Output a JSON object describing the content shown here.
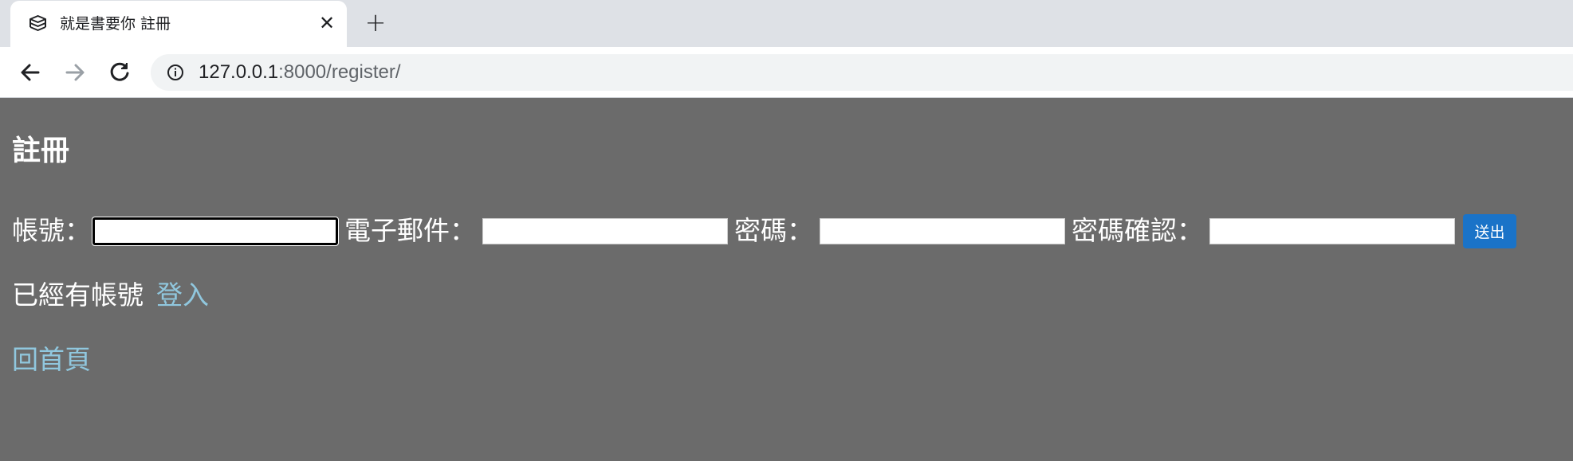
{
  "browser": {
    "tab": {
      "title": "就是書要你 註冊",
      "icon": "books-icon",
      "close_label": "✕"
    },
    "new_tab_label": "+",
    "toolbar": {
      "back_icon": "arrow-left-icon",
      "forward_icon": "arrow-right-icon",
      "reload_icon": "reload-icon",
      "site_info_icon": "info-icon",
      "url_host": "127.0.0.1",
      "url_rest": ":8000/register/"
    }
  },
  "page": {
    "title": "註冊",
    "form": {
      "username_label": "帳號：",
      "username_value": "",
      "email_label": "電子郵件：",
      "email_value": "",
      "password_label": "密碼：",
      "password_value": "",
      "confirm_label": "密碼確認：",
      "confirm_value": "",
      "submit_label": "送出"
    },
    "have_account_text": "已經有帳號",
    "login_link": "登入",
    "home_link": "回首頁"
  },
  "colors": {
    "page_background": "#6b6b6b",
    "link": "#90c7de",
    "submit_button": "#1a73c8"
  }
}
